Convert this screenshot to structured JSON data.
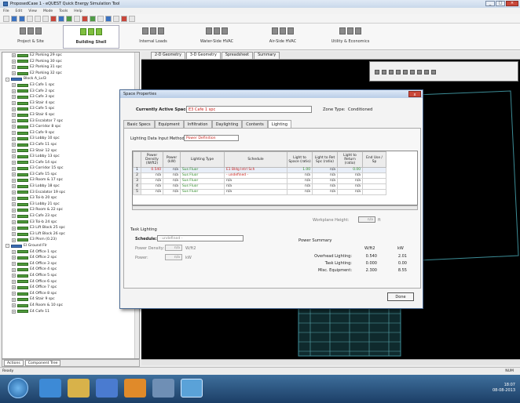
{
  "window": {
    "title": "ProposedCase 1 - eQUEST Quick Energy Simulation Tool"
  },
  "menu": [
    "File",
    "Edit",
    "View",
    "Mode",
    "Tools",
    "Help"
  ],
  "modules": [
    {
      "label": "Project & Site"
    },
    {
      "label": "Building Shell",
      "active": true
    },
    {
      "label": "Internal Loads"
    },
    {
      "label": "Water-Side HVAC"
    },
    {
      "label": "Air-Side HVAC"
    },
    {
      "label": "Utility & Economics"
    }
  ],
  "view_tabs": [
    "2-D Geometry",
    "3-D Geometry",
    "Spreadsheet",
    "Summary"
  ],
  "tree": {
    "items": [
      {
        "label": "E2 Parking 29 spc",
        "level": 1
      },
      {
        "label": "E2 Parking 30 spc",
        "level": 1
      },
      {
        "label": "E2 Parking 31 spc",
        "level": 1
      },
      {
        "label": "E2 Parking 32 spc",
        "level": 1
      },
      {
        "label": "Block A_Lvl3",
        "level": 0
      },
      {
        "label": "E3 Cafe 1 spc",
        "level": 1
      },
      {
        "label": "E3 Cafe 2 spc",
        "level": 1
      },
      {
        "label": "E3 Cafe 3 spc",
        "level": 1
      },
      {
        "label": "E3 Stair 4 spc",
        "level": 1
      },
      {
        "label": "E3 Cafe 5 spc",
        "level": 1
      },
      {
        "label": "E3 Stair 6 spc",
        "level": 1
      },
      {
        "label": "E3 Escalator 7 spc",
        "level": 1
      },
      {
        "label": "E3 Corridor 8 spc",
        "level": 1
      },
      {
        "label": "E3 Cafe 9 spc",
        "level": 1
      },
      {
        "label": "E3 Lobby 10 spc",
        "level": 1
      },
      {
        "label": "E3 Cafe 11 spc",
        "level": 1
      },
      {
        "label": "E3 Stair 12 spc",
        "level": 1
      },
      {
        "label": "E3 Lobby 13 spc",
        "level": 1
      },
      {
        "label": "E3 Cafe 14 spc",
        "level": 1
      },
      {
        "label": "E3 Corridor 15 spc",
        "level": 1
      },
      {
        "label": "E3 Cafe 15 spc",
        "level": 1
      },
      {
        "label": "E3 Room & 17 spc",
        "level": 1
      },
      {
        "label": "E3 Lobby 18 spc",
        "level": 1
      },
      {
        "label": "E3 Escalator 19 spc",
        "level": 1
      },
      {
        "label": "E3 Toi-b 20 spc",
        "level": 1
      },
      {
        "label": "E3 Lobby 21 spc",
        "level": 1
      },
      {
        "label": "E3 Room & 22 spc",
        "level": 1
      },
      {
        "label": "E3 Cafe 23 spc",
        "level": 1
      },
      {
        "label": "E3 Toi-b 24 spc",
        "level": 1
      },
      {
        "label": "E3 Lift Block 25 spc",
        "level": 1
      },
      {
        "label": "E3 Lift Block 26 spc",
        "level": 1
      },
      {
        "label": "E3 Plnm (0.23)",
        "level": 1
      },
      {
        "label": "EI Ground Flr",
        "level": 0
      },
      {
        "label": "E4 Office 1 spc",
        "level": 1
      },
      {
        "label": "E4 Office 2 spc",
        "level": 1
      },
      {
        "label": "E4 Office 3 spc",
        "level": 1
      },
      {
        "label": "E4 Office 4 spc",
        "level": 1
      },
      {
        "label": "E4 Office 5 spc",
        "level": 1
      },
      {
        "label": "E4 Office 6 spc",
        "level": 1
      },
      {
        "label": "E4 Office 7 spc",
        "level": 1
      },
      {
        "label": "E4 Office 8 spc",
        "level": 1
      },
      {
        "label": "E4 Stair 9 spc",
        "level": 1
      },
      {
        "label": "E4 Room & 10 spc",
        "level": 1
      },
      {
        "label": "E4 Cafe 11",
        "level": 1
      }
    ],
    "tabs": [
      "Actions",
      "Component Tree"
    ]
  },
  "dialog": {
    "title": "Space Properties",
    "close_label": "x",
    "active_space_label": "Currently Active Space:",
    "active_space_value": "E3 Cafe 1 spc",
    "zone_type_label": "Zone Type:",
    "zone_type_value": "Conditioned",
    "tabs": [
      "Basic Specs",
      "Equipment",
      "Infiltration",
      "Daylighting",
      "Contents",
      "Lighting"
    ],
    "ldim_label": "Lighting Data Input Method:",
    "ldim_value": "Power Definition",
    "grid": {
      "headers": [
        "Power Density (W/ft2)",
        "Power (kW)",
        "Lighting Type",
        "Schedule",
        "Light to Space (ratio)",
        "Light to Ret Spc (ratio)",
        "Light to Return (ratio)",
        "End Use / Sp"
      ],
      "rows": [
        [
          "1",
          "0.540",
          "n/a",
          "Sus Fluor",
          "E1 Bldg Intrl Sch",
          "1.00",
          "n/a",
          "0.00",
          ""
        ],
        [
          "2",
          "n/a",
          "n/a",
          "Sus Fluor",
          "- undefined -",
          "n/a",
          "n/a",
          "n/a",
          ""
        ],
        [
          "3",
          "n/a",
          "n/a",
          "Sus Fluor",
          "n/a",
          "n/a",
          "n/a",
          "n/a",
          ""
        ],
        [
          "4",
          "n/a",
          "n/a",
          "Sus Fluor",
          "n/a",
          "n/a",
          "n/a",
          "n/a",
          ""
        ],
        [
          "5",
          "n/a",
          "n/a",
          "Sus Fluor",
          "n/a",
          "n/a",
          "n/a",
          "n/a",
          ""
        ]
      ]
    },
    "workplane_label": "Workplane Height:",
    "workplane_value": "n/a",
    "workplane_unit": "ft",
    "task_title": "Task Lighting",
    "sched_label": "Schedule:",
    "sched_value": "- undefined -",
    "pd_label": "Power Density:",
    "pd_value": "n/a",
    "pd_unit": "W/ft2",
    "pw_label": "Power:",
    "pw_value": "n/a",
    "pw_unit": "kW",
    "power_summary": {
      "title": "Power Summary",
      "col1": "W/ft2",
      "col2": "kW",
      "rows": [
        {
          "label": "Overhead Lighting:",
          "v1": "0.540",
          "v2": "2.01"
        },
        {
          "label": "Task Lighting:",
          "v1": "0.000",
          "v2": "0.00"
        },
        {
          "label": "Misc. Equipment:",
          "v1": "2.300",
          "v2": "8.55"
        }
      ]
    },
    "done_label": "Done"
  },
  "status": {
    "left": "Ready",
    "right": "NUM"
  },
  "tray": {
    "time": "18:07",
    "date": "08-08-2013"
  }
}
